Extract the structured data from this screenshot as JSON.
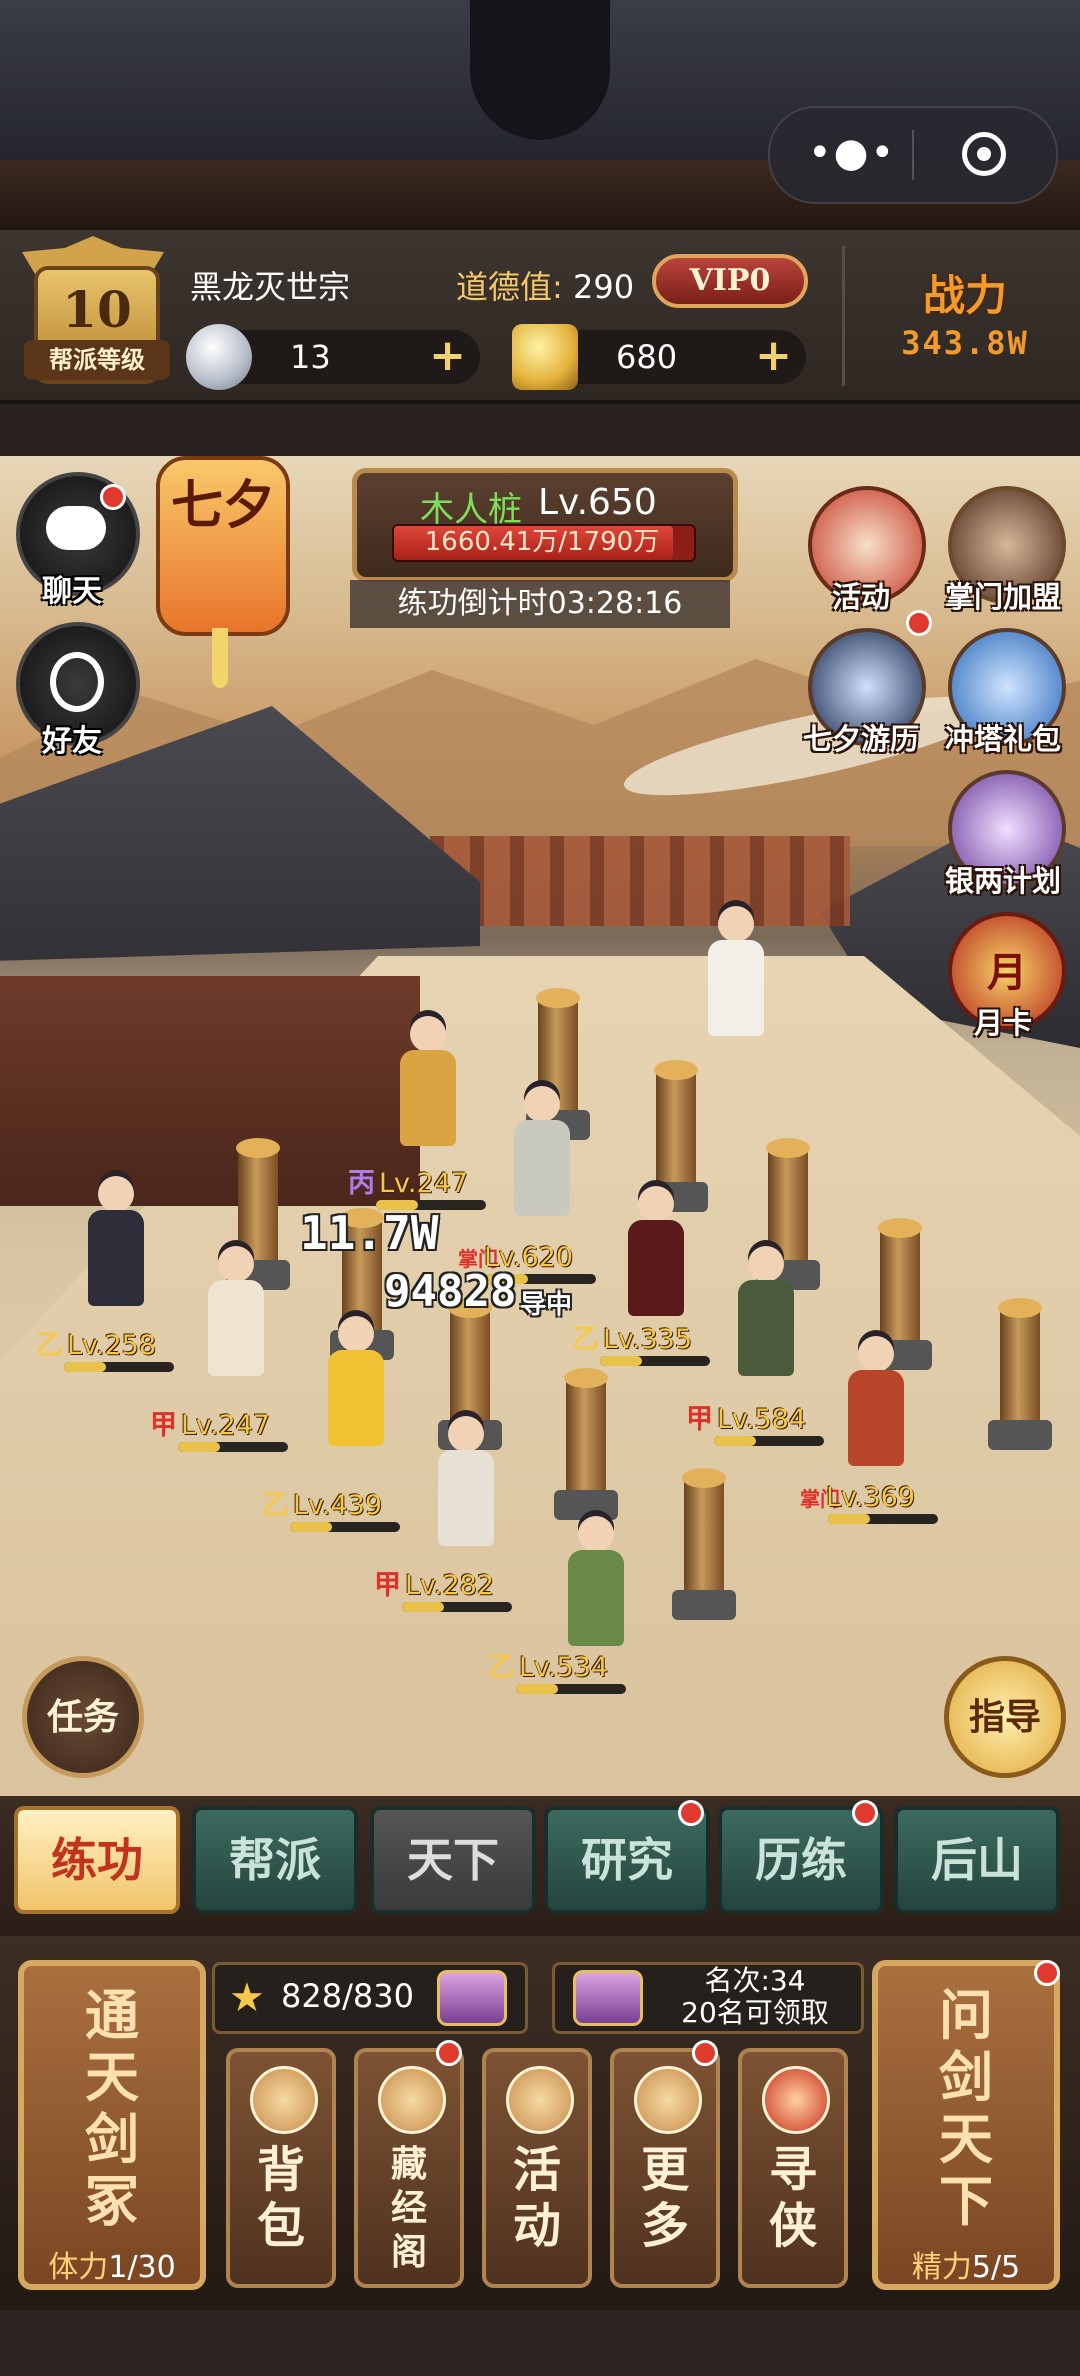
{
  "header": {
    "guild_level_badge": {
      "level": "10",
      "label": "帮派等级"
    },
    "guild_name": "黑龙灭世宗",
    "morality_label": "道德值:",
    "morality_value": "290",
    "vip": "VIP0",
    "silver": "13",
    "gold": "680",
    "power_label": "战力",
    "power_value": "343.8W"
  },
  "left_buttons": {
    "chat": "聊天",
    "friends": "好友"
  },
  "festival_lantern": "七夕",
  "boss": {
    "name": "木人桩",
    "level": "Lv.650",
    "hp": "1660.41万/1790万",
    "hp_fraction": 0.93,
    "countdown": "练功倒计时03:28:16"
  },
  "activity_icons": [
    {
      "label": "活动",
      "icon": "drum-icon",
      "badge": false
    },
    {
      "label": "掌门加盟",
      "icon": "master-portrait-icon",
      "badge": false
    },
    {
      "label": "七夕游历",
      "icon": "magpie-icon",
      "badge": true
    },
    {
      "label": "冲塔礼包",
      "icon": "pagoda-icon",
      "badge": false
    },
    {
      "label": "银两计划",
      "icon": "silver-pot-icon",
      "badge": false
    },
    {
      "label": "月卡",
      "icon": "month-card-icon",
      "badge": false
    }
  ],
  "monthly_card_glyph": "月",
  "floating_damage": [
    "11.7W",
    "94828"
  ],
  "disciples": [
    {
      "grade": "丙",
      "level": "Lv.247",
      "grade_color": "#b07ce8"
    },
    {
      "grade": "掌门",
      "level": "Lv.620",
      "grade_color": "#e0302a"
    },
    {
      "grade": "乙",
      "level": "Lv.258",
      "grade_color": "#f5c74a"
    },
    {
      "grade": "乙",
      "level": "Lv.335",
      "grade_color": "#f5c74a"
    },
    {
      "grade": "甲",
      "level": "Lv.247",
      "grade_color": "#e0302a"
    },
    {
      "grade": "甲",
      "level": "Lv.584",
      "grade_color": "#e0302a"
    },
    {
      "grade": "乙",
      "level": "Lv.439",
      "grade_color": "#f5c74a"
    },
    {
      "grade": "掌门",
      "level": "Lv.369",
      "grade_color": "#e0302a"
    },
    {
      "grade": "甲",
      "level": "Lv.282",
      "grade_color": "#e0302a"
    },
    {
      "grade": "乙",
      "level": "Lv.534",
      "grade_color": "#f5c74a"
    }
  ],
  "guiding_tag": "导中",
  "scene_buttons": {
    "tasks": "任务",
    "guide": "指导"
  },
  "tabs": [
    {
      "label": "练功",
      "active": true,
      "badge": false
    },
    {
      "label": "帮派",
      "active": false,
      "badge": false
    },
    {
      "label": "天下",
      "active": false,
      "badge": false
    },
    {
      "label": "研究",
      "active": false,
      "badge": true
    },
    {
      "label": "历练",
      "active": false,
      "badge": true
    },
    {
      "label": "后山",
      "active": false,
      "badge": false
    }
  ],
  "bottom": {
    "left_card": {
      "title": "通天剑冢",
      "stat_label": "体力",
      "stat_value": "1/30"
    },
    "right_card": {
      "title": "问剑天下",
      "stat_label": "精力",
      "stat_value": "5/5"
    },
    "star_progress": "828/830",
    "rank_text": "名次:34",
    "claim_text": "20名可领取",
    "small_cards": [
      {
        "label": "背包",
        "icon": "money-bag-icon",
        "badge": false
      },
      {
        "label": "藏经阁",
        "icon": "pavilion-icon",
        "badge": true
      },
      {
        "label": "活动",
        "icon": "lantern-icon",
        "badge": false
      },
      {
        "label": "更多",
        "icon": "butterfly-knot-icon",
        "badge": true
      },
      {
        "label": "寻侠",
        "icon": "scroll-icon",
        "badge": false
      }
    ]
  },
  "colors": {
    "accent_red": "#c2331e",
    "gold": "#f0c46a",
    "tab_green": "#3d6a5f"
  }
}
